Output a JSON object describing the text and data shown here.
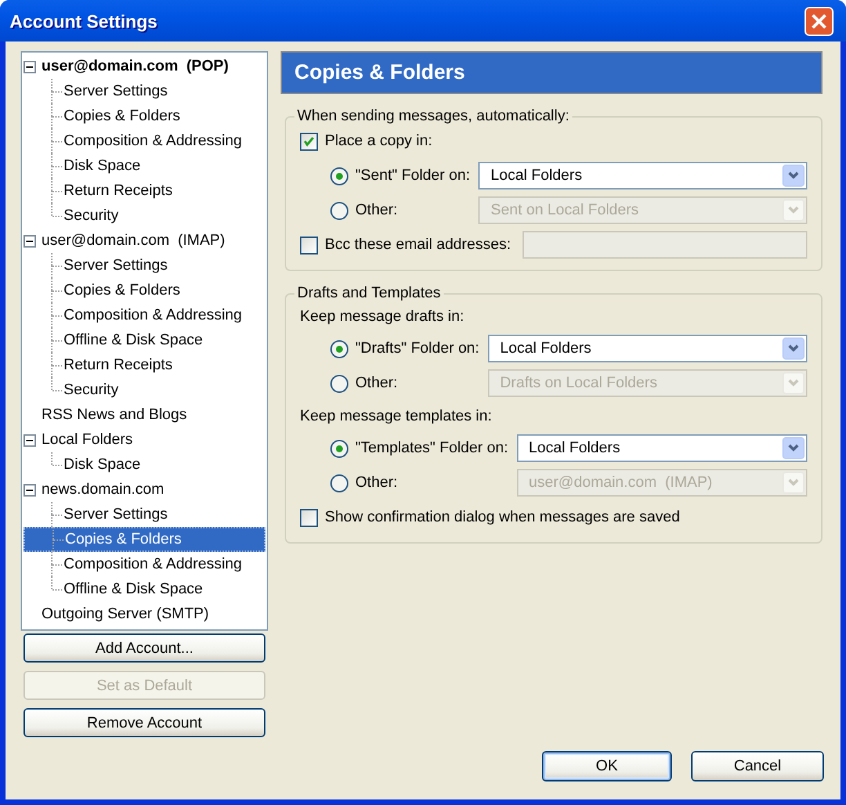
{
  "window": {
    "title": "Account Settings"
  },
  "tree": [
    {
      "label": "user@domain.com  (POP)",
      "default": true,
      "expanded": true,
      "selected": false,
      "children": [
        {
          "label": "Server Settings",
          "selected": false
        },
        {
          "label": "Copies & Folders",
          "selected": false
        },
        {
          "label": "Composition & Addressing",
          "selected": false
        },
        {
          "label": "Disk Space",
          "selected": false
        },
        {
          "label": "Return Receipts",
          "selected": false
        },
        {
          "label": "Security",
          "selected": false
        }
      ]
    },
    {
      "label": "user@domain.com  (IMAP)",
      "default": false,
      "expanded": true,
      "selected": false,
      "children": [
        {
          "label": "Server Settings",
          "selected": false
        },
        {
          "label": "Copies & Folders",
          "selected": false
        },
        {
          "label": "Composition & Addressing",
          "selected": false
        },
        {
          "label": "Offline & Disk Space",
          "selected": false
        },
        {
          "label": "Return Receipts",
          "selected": false
        },
        {
          "label": "Security",
          "selected": false
        }
      ]
    },
    {
      "label": "RSS News and Blogs",
      "default": false,
      "selected": false
    },
    {
      "label": "Local Folders",
      "default": false,
      "expanded": true,
      "selected": false,
      "children": [
        {
          "label": "Disk Space",
          "selected": false
        }
      ]
    },
    {
      "label": "news.domain.com",
      "default": false,
      "expanded": true,
      "selected": false,
      "children": [
        {
          "label": "Server Settings",
          "selected": false
        },
        {
          "label": "Copies & Folders",
          "selected": true
        },
        {
          "label": "Composition & Addressing",
          "selected": false
        },
        {
          "label": "Offline & Disk Space",
          "selected": false
        }
      ]
    },
    {
      "label": "Outgoing Server (SMTP)",
      "default": false,
      "selected": false
    }
  ],
  "account_buttons": [
    {
      "label": "Add Account...",
      "disabled": false
    },
    {
      "label": "Set as Default",
      "disabled": true
    },
    {
      "label": "Remove Account",
      "disabled": false
    }
  ],
  "panel_title": "Copies & Folders",
  "sending": {
    "legend": "When sending messages, automatically:",
    "place_copy": {
      "label": "Place a copy in:",
      "checked": true
    },
    "options": [
      {
        "label": "\"Sent\" Folder on:",
        "selected": true,
        "dropdown": {
          "value": "Local Folders",
          "disabled": false
        }
      },
      {
        "label": "Other:",
        "selected": false,
        "dropdown": {
          "value": "Sent on Local Folders",
          "disabled": true
        }
      }
    ],
    "bcc": {
      "label": "Bcc these email addresses:",
      "checked": false,
      "field": {
        "disabled": true
      }
    }
  },
  "drafts": {
    "legend": "Drafts and Templates",
    "groups": [
      {
        "heading": "Keep message drafts in:",
        "options": [
          {
            "label": "\"Drafts\" Folder on:",
            "selected": true,
            "dropdown": {
              "value": "Local Folders",
              "disabled": false
            }
          },
          {
            "label": "Other:",
            "selected": false,
            "dropdown": {
              "value": "Drafts on Local Folders",
              "disabled": true
            }
          }
        ]
      },
      {
        "heading": "Keep message templates in:",
        "options": [
          {
            "label": "\"Templates\" Folder on:",
            "selected": true,
            "dropdown": {
              "value": "Local Folders",
              "disabled": false
            }
          },
          {
            "label": "Other:",
            "selected": false,
            "dropdown": {
              "value": "user@domain.com  (IMAP)",
              "disabled": true
            }
          }
        ]
      }
    ],
    "confirm": {
      "label": "Show confirmation dialog when messages are saved",
      "checked": false
    }
  },
  "buttons": [
    {
      "label": "OK",
      "default": true
    },
    {
      "label": "Cancel",
      "default": false
    }
  ]
}
